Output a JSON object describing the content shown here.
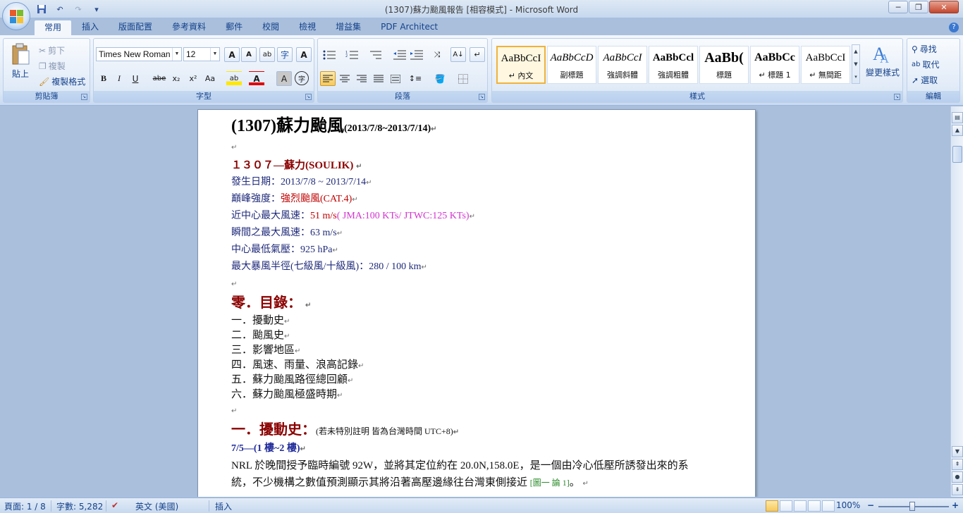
{
  "window": {
    "title": "(1307)蘇力颱風報告 [相容模式] - Microsoft Word",
    "controls": {
      "minimize": "─",
      "restore": "❐",
      "close": "✕"
    }
  },
  "quick_access": {
    "save_icon": "save-icon",
    "undo_glyph": "↶",
    "redo_glyph": "↷",
    "customize_glyph": "▾"
  },
  "tabs": [
    "常用",
    "插入",
    "版面配置",
    "參考資料",
    "郵件",
    "校閱",
    "檢視",
    "增益集",
    "PDF Architect"
  ],
  "ribbon": {
    "clipboard": {
      "label": "剪貼簿",
      "paste": "貼上",
      "cut": "剪下",
      "copy": "複製",
      "format_painter": "複製格式"
    },
    "font": {
      "label": "字型",
      "font_name": "Times New Roman",
      "font_size": "12",
      "grow": "A",
      "shrink": "A",
      "phonetic": "ab",
      "enclose": "字",
      "clear": "A",
      "bold": "B",
      "italic": "I",
      "underline": "U",
      "strike": "abe",
      "subscript": "x₂",
      "superscript": "x²",
      "change_case": "Aa",
      "highlight": "ab",
      "font_color": "A",
      "char_shading": "A",
      "char_border": "字"
    },
    "paragraph": {
      "label": "段落"
    },
    "styles": {
      "label": "樣式",
      "items": [
        {
          "sample": "AaBbCcI",
          "name": "↵ 內文"
        },
        {
          "sample": "AaBbCcD",
          "name": "副標題"
        },
        {
          "sample": "AaBbCcI",
          "name": "強調斜體"
        },
        {
          "sample": "AaBbCcl",
          "name": "強調粗體"
        },
        {
          "sample": "AaBb(",
          "name": "標題"
        },
        {
          "sample": "AaBbCc",
          "name": "↵ 標題 1"
        },
        {
          "sample": "AaBbCcI",
          "name": "↵ 無間距"
        }
      ],
      "change_styles": "變更樣式"
    },
    "editing": {
      "label": "編輯",
      "find": "尋找",
      "replace": "取代",
      "select": "選取"
    }
  },
  "document": {
    "heading": {
      "main": "(1307)蘇力颱風",
      "dates": "(2013/7/8~2013/7/14)"
    },
    "para_mark": "↵",
    "storm_title": "１３０７—蘇力(SOULIK)",
    "info": [
      {
        "label": "發生日期：",
        "value": "2013/7/8 ~ 2013/7/14",
        "extra": ""
      },
      {
        "label": "巔峰強度：",
        "value": "強烈颱風(CAT.4)",
        "extra": ""
      },
      {
        "label": "近中心最大風速：",
        "value": "51 m/s",
        "extra": "( JMA:100 KTs/ JTWC:125 KTs)"
      },
      {
        "label": "瞬間之最大風速：",
        "value": "63 m/s",
        "extra": ""
      },
      {
        "label": "中心最低氣壓：",
        "value": "925 hPa",
        "extra": ""
      },
      {
        "label": "最大暴風半徑(七級風/十級風)：",
        "value": "280 / 100 km",
        "extra": ""
      }
    ],
    "toc_title": "零．目錄：",
    "toc": [
      "一．擾動史",
      "二．颱風史",
      "三．影響地區",
      "四．風速、雨量、浪高記錄",
      "五．蘇力颱風路徑總回顧",
      "六．蘇力颱風極盛時期"
    ],
    "section1_title": "一．擾動史：",
    "section1_note": "(若未特別註明 皆為台灣時間 UTC+8)",
    "sub_heading": "7/5—(1 樓~2 樓)",
    "body_line1": "NRL 於晚間授予臨時編號 92W，並將其定位約在 20.0N,158.0E，是一個由冷心低壓所誘發出來的系",
    "body_line2": "統，不少機構之數值預測顯示其將沿著高壓邊緣往台灣東側接近",
    "body_ref": "[圖一 論 1]",
    "body_end": "。"
  },
  "statusbar": {
    "page": "頁面: 1 / 8",
    "words": "字數: 5,282",
    "language": "英文 (美國)",
    "mode": "插入",
    "zoom": "100%",
    "zoom_minus": "−",
    "zoom_plus": "+"
  }
}
